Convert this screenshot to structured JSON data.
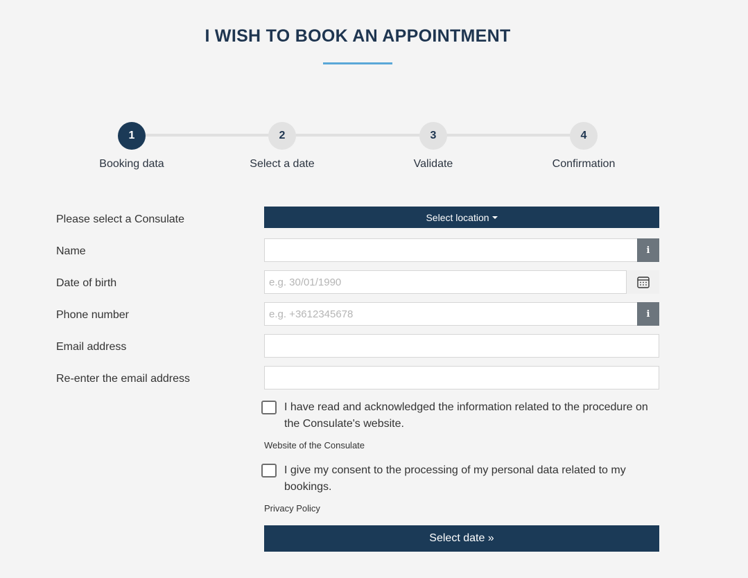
{
  "page": {
    "title": "I WISH TO BOOK AN APPOINTMENT"
  },
  "stepper": {
    "steps": [
      {
        "number": "1",
        "label": "Booking data",
        "active": true
      },
      {
        "number": "2",
        "label": "Select a date",
        "active": false
      },
      {
        "number": "3",
        "label": "Validate",
        "active": false
      },
      {
        "number": "4",
        "label": "Confirmation",
        "active": false
      }
    ]
  },
  "form": {
    "consulate": {
      "label": "Please select a Consulate",
      "button": "Select location"
    },
    "name": {
      "label": "Name",
      "value": "",
      "placeholder": "",
      "addon_icon": "info-icon"
    },
    "dob": {
      "label": "Date of birth",
      "value": "",
      "placeholder": "e.g. 30/01/1990",
      "addon_icon": "calendar-icon"
    },
    "phone": {
      "label": "Phone number",
      "value": "",
      "placeholder": "e.g. +3612345678",
      "addon_icon": "info-icon"
    },
    "email": {
      "label": "Email address",
      "value": "",
      "placeholder": ""
    },
    "email_confirm": {
      "label": "Re-enter the email address",
      "value": "",
      "placeholder": ""
    },
    "ack": {
      "text": "I have read and acknowledged the information related to the procedure on the Consulate's website.",
      "checked": false,
      "link": "Website of the Consulate"
    },
    "consent": {
      "text": "I give my consent to the processing of my personal data related to my bookings.",
      "checked": false,
      "link": "Privacy Policy"
    },
    "submit": "Select date »"
  },
  "colors": {
    "primary": "#1b3a57",
    "accent_rule": "#5aa7d8",
    "addon": "#6c757d",
    "background": "#f4f4f4"
  }
}
